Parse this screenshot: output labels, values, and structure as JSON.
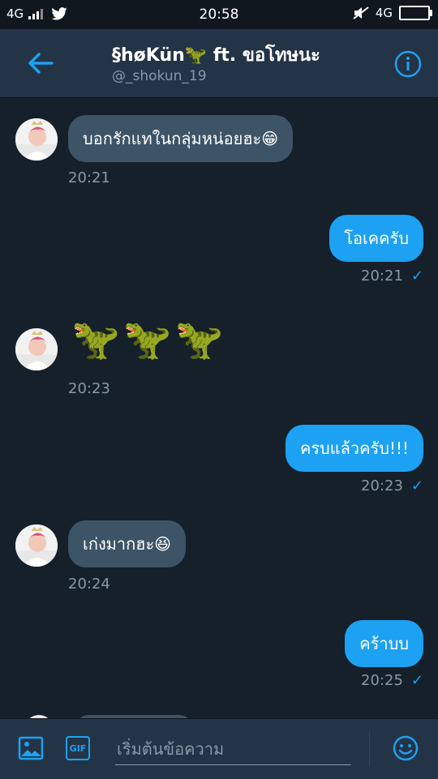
{
  "status": {
    "network_left": "4G",
    "time": "20:58",
    "network_right": "4G"
  },
  "header": {
    "title": "§høKün🦖 ft. ขอโทษนะ",
    "handle": "@_shokun_19"
  },
  "messages": [
    {
      "direction": "in",
      "text": "บอกรักแทในกลุ่มหน่อยฮะ😁",
      "time": "20:21"
    },
    {
      "direction": "out",
      "text": "โอเคครับ",
      "time": "20:21",
      "status": "✓"
    },
    {
      "direction": "in",
      "text": "🦖🦖🦖",
      "time": "20:23"
    },
    {
      "direction": "out",
      "text": "ครบแล้วครับ!!!",
      "time": "20:23",
      "status": "✓"
    },
    {
      "direction": "in",
      "text": "เก่งมากฮะ😆",
      "time": "20:24"
    },
    {
      "direction": "out",
      "text": "คร้าบบ",
      "time": "20:25",
      "status": "✓"
    }
  ],
  "composer": {
    "placeholder": "เริ่มต้นข้อความ",
    "gif_label": "GIF"
  },
  "colors": {
    "background": "#15202b",
    "header": "#243447",
    "accent": "#1da1f2",
    "incoming_bubble": "#3d5466",
    "muted_text": "#8899a6"
  }
}
